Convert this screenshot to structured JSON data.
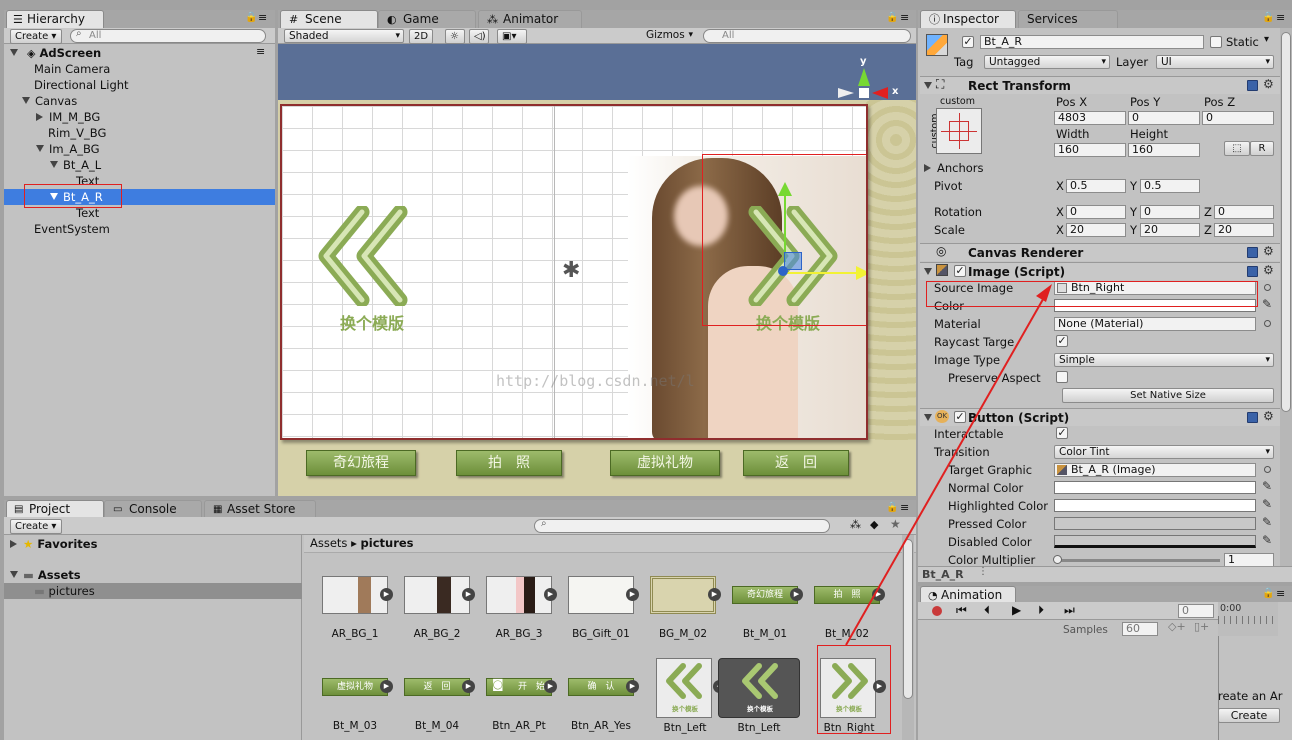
{
  "hierarchy": {
    "tab": "Hierarchy",
    "create_label": "Create",
    "search_placeholder": "All",
    "scene_name": "AdScreen",
    "items": [
      {
        "label": "Main Camera"
      },
      {
        "label": "Directional Light"
      },
      {
        "label": "Canvas"
      },
      {
        "label": "IM_M_BG"
      },
      {
        "label": "Rim_V_BG"
      },
      {
        "label": "Im_A_BG"
      },
      {
        "label": "Bt_A_L"
      },
      {
        "label": "Text"
      },
      {
        "label": "Bt_A_R"
      },
      {
        "label": "Text"
      },
      {
        "label": "EventSystem"
      }
    ]
  },
  "scene": {
    "tabs": [
      {
        "label": "Scene"
      },
      {
        "label": "Game"
      },
      {
        "label": "Animator"
      }
    ],
    "shading": "Shaded",
    "mode_2d": "2D",
    "gizmos": "Gizmos",
    "search_placeholder": "All",
    "axis_y": "y",
    "axis_x": "x",
    "left_button_text": "换个模版",
    "right_button_text": "换个模版",
    "watermark": "http://blog.csdn.net/l",
    "bottom_buttons": [
      {
        "label": "奇幻旅程"
      },
      {
        "label": "拍　照"
      },
      {
        "label": "虚拟礼物"
      },
      {
        "label": "返　回"
      }
    ]
  },
  "inspector": {
    "tabs": [
      {
        "label": "Inspector"
      },
      {
        "label": "Services"
      }
    ],
    "object_name": "Bt_A_R",
    "static_label": "Static",
    "tag_label": "Tag",
    "tag_value": "Untagged",
    "layer_label": "Layer",
    "layer_value": "UI",
    "rect_transform": {
      "title": "Rect Transform",
      "anchor_preset_top": "custom",
      "anchor_preset_side": "custom",
      "pos_x_label": "Pos X",
      "pos_y_label": "Pos Y",
      "pos_z_label": "Pos Z",
      "pos_x": "4803",
      "pos_y": "0",
      "pos_z": "0",
      "width_label": "Width",
      "height_label": "Height",
      "width": "160",
      "height": "160",
      "r_button": "R",
      "anchors_label": "Anchors",
      "pivot_label": "Pivot",
      "pivot_x": "0.5",
      "pivot_y": "0.5",
      "rotation_label": "Rotation",
      "rot_x": "0",
      "rot_y": "0",
      "rot_z": "0",
      "scale_label": "Scale",
      "scale_x": "20",
      "scale_y": "20",
      "scale_z": "20",
      "x": "X",
      "y": "Y",
      "z": "Z"
    },
    "canvas_renderer": {
      "title": "Canvas Renderer"
    },
    "image": {
      "title": "Image (Script)",
      "source_image_label": "Source Image",
      "source_image_value": "Btn_Right",
      "color_label": "Color",
      "material_label": "Material",
      "material_value": "None (Material)",
      "raycast_label": "Raycast Targe",
      "image_type_label": "Image Type",
      "image_type_value": "Simple",
      "preserve_label": "Preserve Aspect",
      "native_size_button": "Set Native Size"
    },
    "button": {
      "title": "Button (Script)",
      "icon_text": "OK",
      "interactable_label": "Interactable",
      "transition_label": "Transition",
      "transition_value": "Color Tint",
      "target_graphic_label": "Target Graphic",
      "target_graphic_value": "Bt_A_R (Image)",
      "normal_label": "Normal Color",
      "highlighted_label": "Highlighted Color",
      "pressed_label": "Pressed Color",
      "disabled_label": "Disabled Color",
      "multiplier_label": "Color Multiplier",
      "multiplier_value": "1"
    },
    "footer_name": "Bt_A_R"
  },
  "animation": {
    "tab": "Animation",
    "frame_value": "0",
    "ruler_label": "0:00",
    "samples_label": "Samples",
    "samples_value": "60",
    "create_text": "reate an Ar",
    "create_button": "Create"
  },
  "project": {
    "tabs": [
      {
        "label": "Project"
      },
      {
        "label": "Console"
      },
      {
        "label": "Asset Store"
      }
    ],
    "create_label": "Create",
    "favorites_label": "Favorites",
    "assets_label": "Assets",
    "pictures_folder": "pictures",
    "breadcrumb_root": "Assets",
    "breadcrumb_current": "pictures",
    "assets": [
      {
        "name": "AR_BG_1"
      },
      {
        "name": "AR_BG_2"
      },
      {
        "name": "AR_BG_3"
      },
      {
        "name": "BG_Gift_01"
      },
      {
        "name": "BG_M_02"
      },
      {
        "name": "Bt_M_01"
      },
      {
        "name": "Bt_M_02"
      },
      {
        "name": "Bt_M_03"
      },
      {
        "name": "Bt_M_04"
      },
      {
        "name": "Btn_AR_Pt"
      },
      {
        "name": "Btn_AR_Yes"
      },
      {
        "name": "Btn_Left"
      },
      {
        "name": "Btn_Left"
      },
      {
        "name": "Btn_Right"
      }
    ],
    "thumb_texts": {
      "bt_m_01": "奇幻旅程",
      "bt_m_02": "拍　照",
      "bt_m_03": "虚拟礼物",
      "bt_m_04": "返　回",
      "btn_ar_pt": "开　始",
      "btn_ar_yes": "确　认",
      "btn_left_1": "换个模板",
      "btn_left_2": "换个模板",
      "btn_right": "换个模板"
    }
  },
  "colors": {
    "selection": "#3e7de0",
    "annotation_red": "#e02020",
    "scene_blue": "#5a6f96",
    "button_green": "#86a652"
  }
}
